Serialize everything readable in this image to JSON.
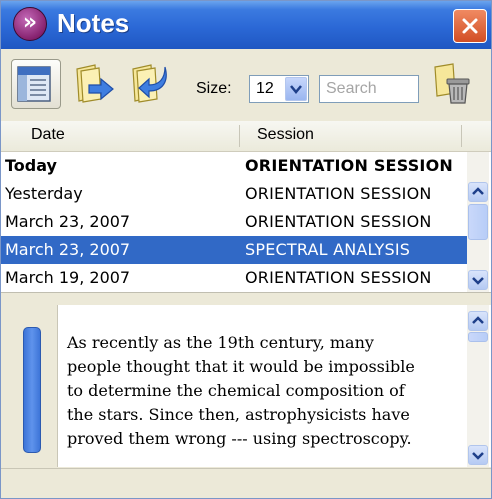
{
  "window": {
    "title": "Notes",
    "accent_color": "#2b68d6",
    "selection_color": "#3169c6"
  },
  "icons": {
    "app": "notes-app-icon",
    "close": "close-icon",
    "notes_list": "notes-list-icon",
    "export": "export-note-icon",
    "import": "import-note-icon",
    "delete": "trash-can-icon",
    "dropdown": "chevron-down-icon",
    "scroll_up": "chevron-up-icon",
    "scroll_down": "chevron-down-icon"
  },
  "toolbar": {
    "size_label": "Size:",
    "size_value": "12",
    "search_placeholder": "Search"
  },
  "list": {
    "columns": [
      "Date",
      "Session"
    ],
    "rows": [
      {
        "date": "Today",
        "session": "ORIENTATION SESSION",
        "bold": true,
        "selected": false
      },
      {
        "date": "Yesterday",
        "session": "ORIENTATION SESSION",
        "bold": false,
        "selected": false
      },
      {
        "date": "March 23, 2007",
        "session": "ORIENTATION SESSION",
        "bold": false,
        "selected": false
      },
      {
        "date": "March 23, 2007",
        "session": "SPECTRAL ANALYSIS",
        "bold": false,
        "selected": true
      },
      {
        "date": "March 19, 2007",
        "session": "ORIENTATION SESSION",
        "bold": false,
        "selected": false
      }
    ]
  },
  "note": {
    "lines": [
      "As recently as the 19th century, many",
      "people thought that it would be impossible",
      "to determine the chemical composition of",
      "the stars. Since then, astrophysicists have",
      "proved them wrong --- using spectroscopy."
    ],
    "color_tab": "#3d75d8"
  }
}
